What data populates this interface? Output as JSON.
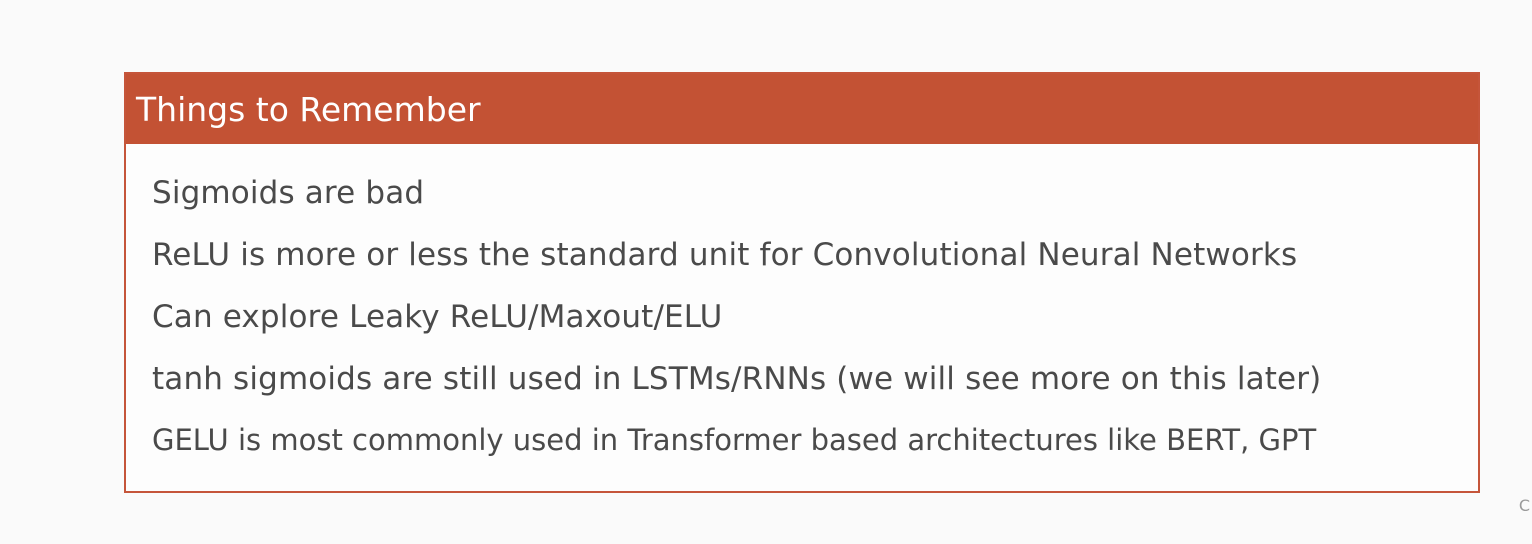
{
  "slide": {
    "box": {
      "title": "Things to Remember",
      "items": [
        "Sigmoids are bad",
        "ReLU is more or less the standard unit for Convolutional Neural Networks",
        "Can explore Leaky ReLU/Maxout/ELU",
        "tanh sigmoids are still used in LSTMs/RNNs (we will see more on this later)",
        "GELU is most commonly used in Transformer based architectures like BERT, GPT"
      ]
    },
    "corner_mark": "C"
  },
  "colors": {
    "header_bg": "#c35234",
    "border": "#c5553a",
    "title_text": "#ffffff",
    "body_text": "#4a4a4a",
    "page_bg": "#fafafa"
  }
}
